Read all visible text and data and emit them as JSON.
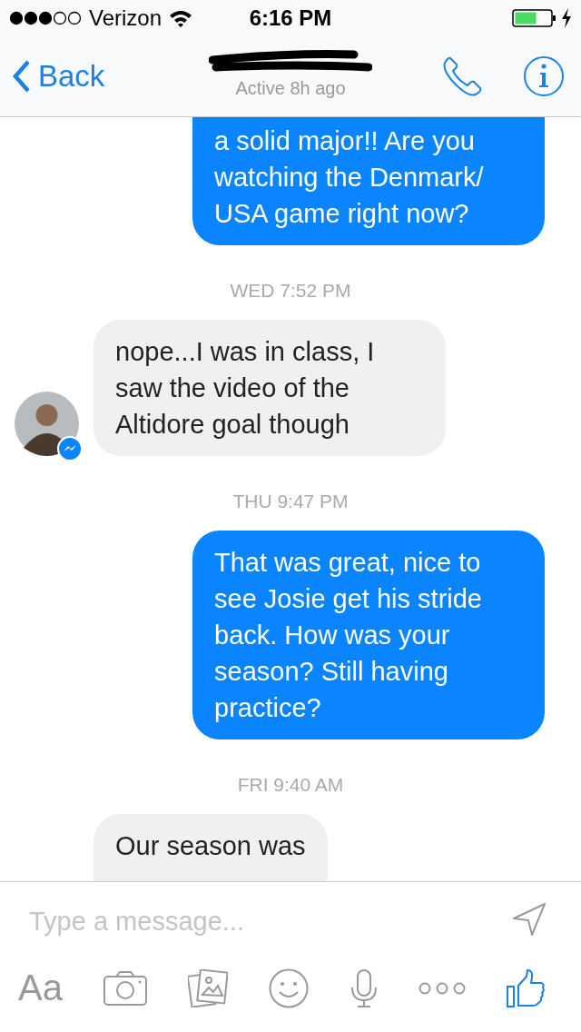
{
  "status_bar": {
    "carrier": "Verizon",
    "time": "6:16 PM"
  },
  "nav": {
    "back": "Back",
    "subtitle": "Active 8h ago"
  },
  "messages": [
    {
      "kind": "sent",
      "text": "a solid major!! Are you watching the Denmark/ USA game right now?",
      "cut_top": true
    },
    {
      "kind": "time",
      "text": "WED 7:52 PM"
    },
    {
      "kind": "received",
      "text": "nope...I was in class, I saw the video of the Altidore goal though",
      "avatar": true
    },
    {
      "kind": "time",
      "text": "THU 9:47 PM"
    },
    {
      "kind": "sent",
      "text": "That was great, nice to see Josie get his stride back. How was your season? Still having practice?"
    },
    {
      "kind": "time",
      "text": "FRI 9:40 AM"
    },
    {
      "kind": "received",
      "text": "Our season was",
      "cut_bottom": true
    }
  ],
  "composer": {
    "placeholder": "Type a message...",
    "font_button": "Aa"
  }
}
